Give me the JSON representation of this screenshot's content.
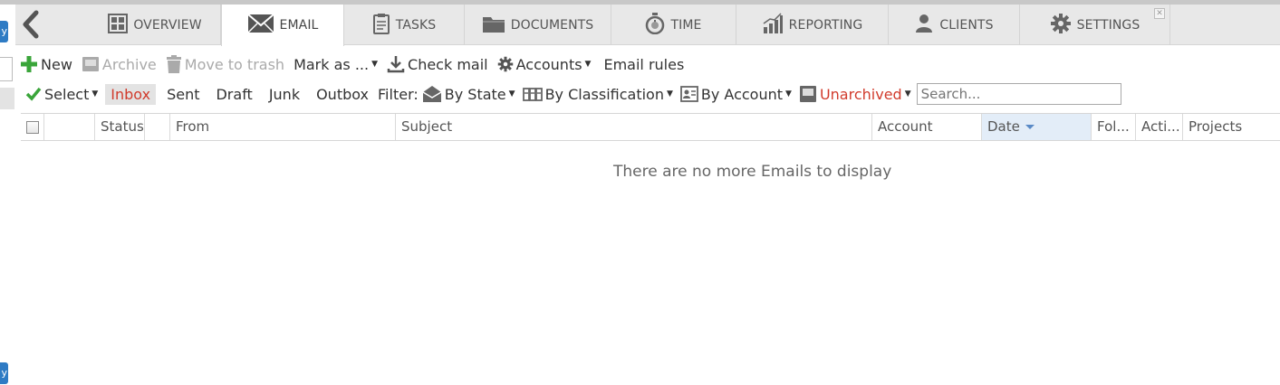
{
  "nav": {
    "tabs": [
      {
        "label": "OVERVIEW",
        "icon": "overview-grid-icon"
      },
      {
        "label": "EMAIL",
        "icon": "envelope-icon",
        "active": true
      },
      {
        "label": "TASKS",
        "icon": "clipboard-icon"
      },
      {
        "label": "DOCUMENTS",
        "icon": "folder-icon"
      },
      {
        "label": "TIME",
        "icon": "stopwatch-icon"
      },
      {
        "label": "REPORTING",
        "icon": "bar-chart-icon"
      },
      {
        "label": "CLIENTS",
        "icon": "person-icon"
      },
      {
        "label": "SETTINGS",
        "icon": "gear-icon"
      }
    ]
  },
  "toolbar": {
    "new": "New",
    "archive": "Archive",
    "trash": "Move to trash",
    "mark_as": "Mark as ...",
    "check_mail": "Check mail",
    "accounts": "Accounts",
    "email_rules": "Email rules"
  },
  "filterbar": {
    "select": "Select",
    "folders": [
      "Inbox",
      "Sent",
      "Draft",
      "Junk",
      "Outbox"
    ],
    "active_folder": "Inbox",
    "filter_label": "Filter:",
    "by_state": "By State",
    "by_classification": "By Classification",
    "by_account": "By Account",
    "unarchived": "Unarchived",
    "search_placeholder": "Search..."
  },
  "grid": {
    "columns": [
      "",
      "",
      "Status",
      "",
      "From",
      "Subject",
      "Account",
      "Date",
      "Fol...",
      "Acti...",
      "Projects"
    ],
    "sorted_column": "Date",
    "empty_message": "There are no more Emails to display"
  },
  "colors": {
    "accent_red": "#d13b2c",
    "accent_green": "#3aa53a",
    "nav_bg": "#e8e8e8",
    "sort_bg": "#e3edf8"
  }
}
